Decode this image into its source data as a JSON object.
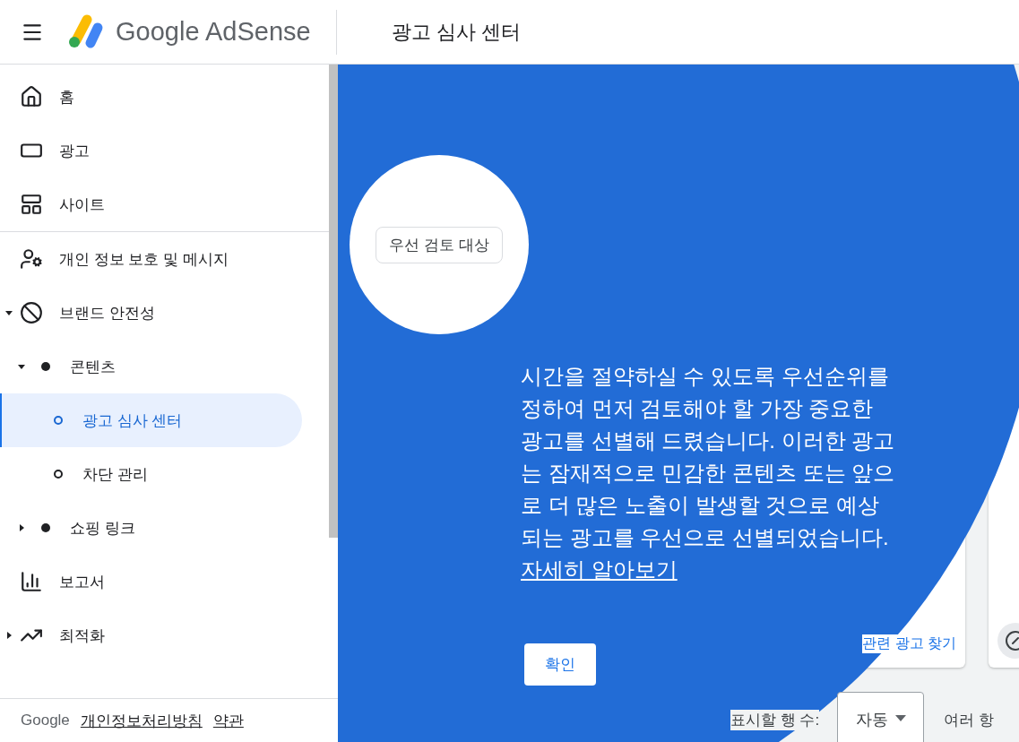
{
  "header": {
    "product": "Google AdSense",
    "page_title": "광고 심사 센터"
  },
  "sidebar": {
    "groups": [
      {
        "items": [
          {
            "label": "홈",
            "selected": false
          },
          {
            "label": "광고",
            "selected": false
          },
          {
            "label": "사이트",
            "selected": false
          }
        ]
      },
      {
        "items": [
          {
            "label": "개인 정보 보호 및 메시지",
            "selected": false
          },
          {
            "label": "브랜드 안전성",
            "selected": false,
            "expanded": true,
            "children": [
              {
                "label": "콘텐츠",
                "selected": false,
                "expanded": true,
                "children": [
                  {
                    "label": "광고 심사 센터",
                    "selected": true
                  },
                  {
                    "label": "차단 관리",
                    "selected": false
                  }
                ]
              },
              {
                "label": "쇼핑 링크",
                "selected": false,
                "expanded": false
              }
            ]
          },
          {
            "label": "보고서",
            "selected": false
          },
          {
            "label": "최적화",
            "selected": false,
            "expanded": false
          }
        ]
      }
    ]
  },
  "footer": {
    "brand": "Google",
    "links": [
      "개인정보처리방침",
      "약관"
    ]
  },
  "background": {
    "card_action": "관련 광고 찾기",
    "rows_label": "표시할 행 수:",
    "rows_select": "자동",
    "next_label": "여러 항"
  },
  "spotlight": {
    "target_label": "우선 검토 대상",
    "message": "시간을 절약하실 수 있도록 우선순위를 정하여 먼저 검토해야 할 가장 중요한 광고를 선별해 드렸습니다. 이러한 광고는 잠재적으로 민감한 콘텐츠 또는 앞으로 더 많은 노출이 발생할 것으로 예상되는 광고를 우선으로 선별되었습니다. ",
    "link": "자세히 알아보기",
    "button": "확인"
  }
}
